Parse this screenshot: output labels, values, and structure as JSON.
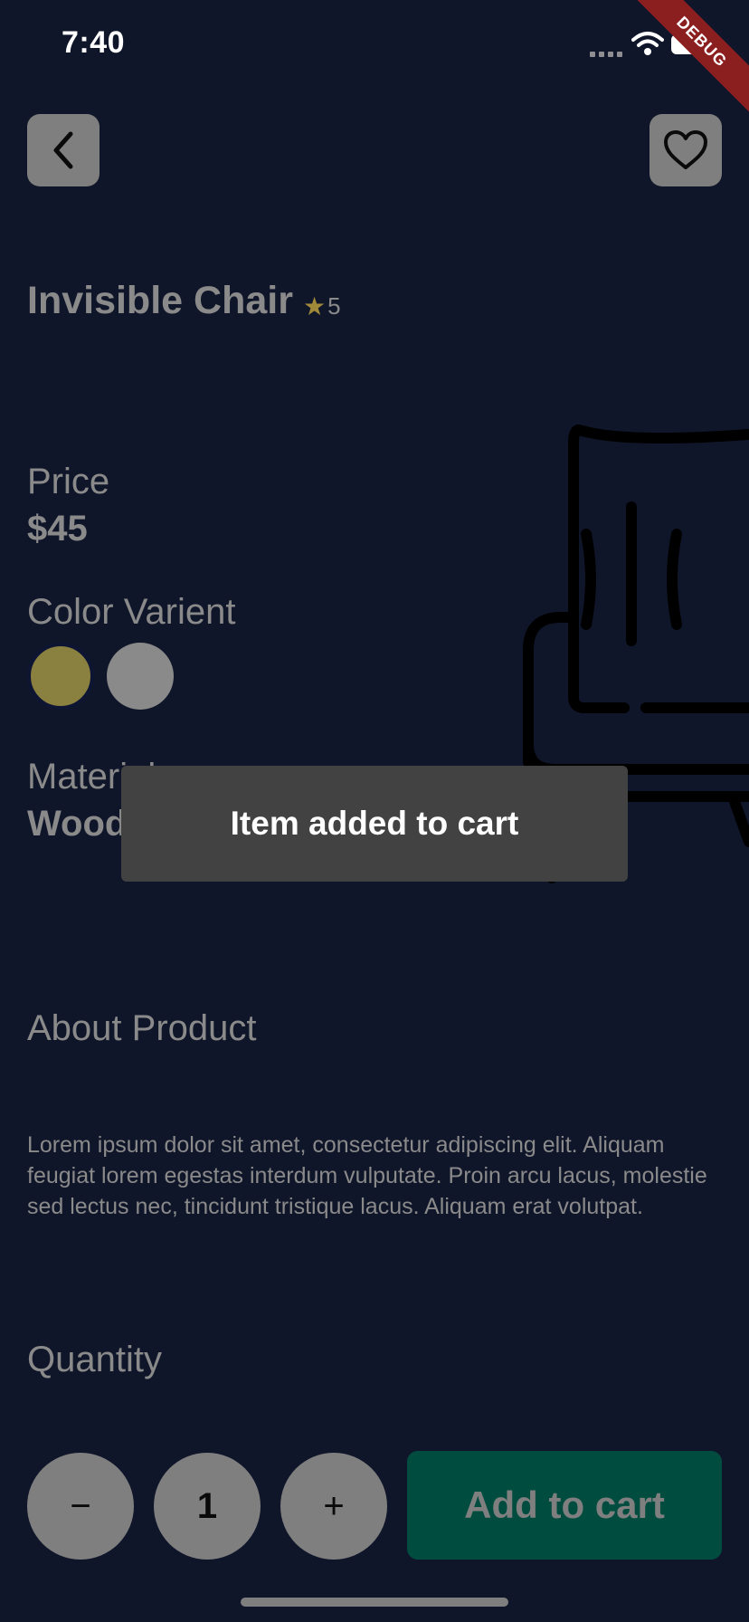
{
  "status_bar": {
    "time": "7:40",
    "debug_banner": "DEBUG"
  },
  "product": {
    "name": "Invisible Chair",
    "rating": "5",
    "price_label": "Price",
    "price": "$45",
    "color_label": "Color Varient",
    "colors": [
      "#8a8040",
      "#8a8a8a"
    ],
    "material_label": "Material",
    "material": "Wood",
    "about_label": "About Product",
    "description": "Lorem ipsum dolor sit amet, consectetur adipiscing elit. Aliquam feugiat lorem egestas interdum vulputate. Proin arcu lacus, molestie sed lectus nec, tincidunt tristique lacus. Aliquam erat volutpat."
  },
  "quantity": {
    "label": "Quantity",
    "value": "1",
    "minus": "−",
    "plus": "+"
  },
  "actions": {
    "add_to_cart": "Add to cart"
  },
  "toast": {
    "message": "Item added to cart"
  },
  "icons": {
    "back": "chevron-left-icon",
    "favorite": "heart-icon",
    "star": "star-icon"
  }
}
